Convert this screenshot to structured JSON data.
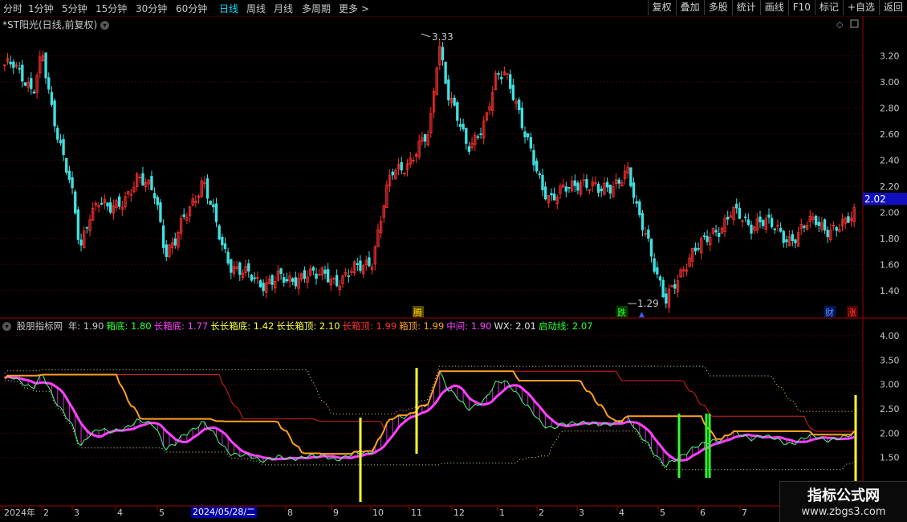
{
  "toolbar": {
    "periods": [
      "分时",
      "1分钟",
      "5分钟",
      "15分钟",
      "30分钟",
      "60分钟",
      "日线",
      "周线",
      "月线",
      "多周期",
      "更多 >"
    ],
    "active_period": "日线",
    "buttons": [
      "复权",
      "叠加",
      "多股",
      "统计",
      "画线",
      "F10",
      "标记",
      "+自选",
      "返回"
    ]
  },
  "chart_title": "*ST阳光(日线,前复权)",
  "price_axis": {
    "ticks": [
      "3.20",
      "3.00",
      "2.80",
      "2.60",
      "2.40",
      "2.20",
      "2.00",
      "1.80",
      "1.60",
      "1.40"
    ],
    "current_price_label": "2.02"
  },
  "annotations": {
    "high_label": "3.33",
    "low_label": "1.29",
    "markers": [
      {
        "text": "腾",
        "color": "#ffd000"
      },
      {
        "text": "跌",
        "color": "#00c000"
      },
      {
        "text": "财",
        "color": "#3060ff"
      },
      {
        "text": "涨",
        "color": "#ff2020"
      }
    ]
  },
  "indicator": {
    "name": "股朋指标网",
    "items": [
      {
        "label": "年:",
        "value": "1.90",
        "color": "#c8c8c8"
      },
      {
        "label": "箱底:",
        "value": "1.80",
        "color": "#30ff30"
      },
      {
        "label": "长箱底:",
        "value": "1.77",
        "color": "#ff40ff"
      },
      {
        "label": "长长箱底:",
        "value": "1.42",
        "color": "#ffff40"
      },
      {
        "label": "长长箱顶:",
        "value": "2.10",
        "color": "#ffff40"
      },
      {
        "label": "长箱顶:",
        "value": "1.99",
        "color": "#ff3030"
      },
      {
        "label": "箱顶:",
        "value": "1.99",
        "color": "#ffa020"
      },
      {
        "label": "中间:",
        "value": "1.90",
        "color": "#ff40ff"
      },
      {
        "label": "WX:",
        "value": "2.01",
        "color": "#e0e0e0"
      },
      {
        "label": "启动线:",
        "value": "2.07",
        "color": "#30ff30"
      }
    ],
    "axis_ticks": [
      "4.00",
      "3.50",
      "3.00",
      "2.50",
      "2.00",
      "1.50"
    ]
  },
  "time_axis": {
    "labels": [
      "2024年",
      "2",
      "3",
      "4",
      "5",
      "6",
      "7",
      "8",
      "9",
      "10",
      "11",
      "12",
      "1",
      "2",
      "3",
      "4",
      "5",
      "6",
      "7"
    ],
    "cursor_date": "2024/05/28/二"
  },
  "chart_data": {
    "type": "candlestick",
    "title": "*ST阳光(日线,前复权)",
    "ylim": [
      1.3,
      3.35
    ],
    "close_series": [
      3.1,
      3.15,
      3.05,
      2.9,
      3.2,
      2.8,
      2.5,
      2.2,
      1.7,
      2.0,
      2.1,
      2.0,
      2.05,
      2.15,
      2.25,
      2.2,
      2.15,
      1.7,
      1.75,
      1.95,
      2.1,
      2.25,
      2.0,
      1.75,
      1.6,
      1.55,
      1.5,
      1.45,
      1.48,
      1.5,
      1.45,
      1.5,
      1.55,
      1.5,
      1.52,
      1.48,
      1.5,
      1.55,
      1.6,
      1.65,
      2.0,
      2.3,
      2.35,
      2.4,
      2.5,
      2.6,
      3.33,
      2.9,
      2.7,
      2.5,
      2.6,
      2.7,
      3.0,
      3.1,
      2.9,
      2.6,
      2.4,
      2.2,
      2.1,
      2.15,
      2.2,
      2.25,
      2.2,
      2.15,
      2.2,
      2.25,
      2.3,
      2.0,
      1.85,
      1.55,
      1.29,
      1.45,
      1.6,
      1.7,
      1.75,
      1.85,
      1.9,
      2.0,
      1.95,
      1.9,
      1.95,
      1.9,
      1.85,
      1.8,
      1.82,
      1.9,
      1.95,
      1.88,
      1.85,
      1.9,
      2.02
    ],
    "high": 3.33,
    "low": 1.29,
    "last": 2.02
  }
}
